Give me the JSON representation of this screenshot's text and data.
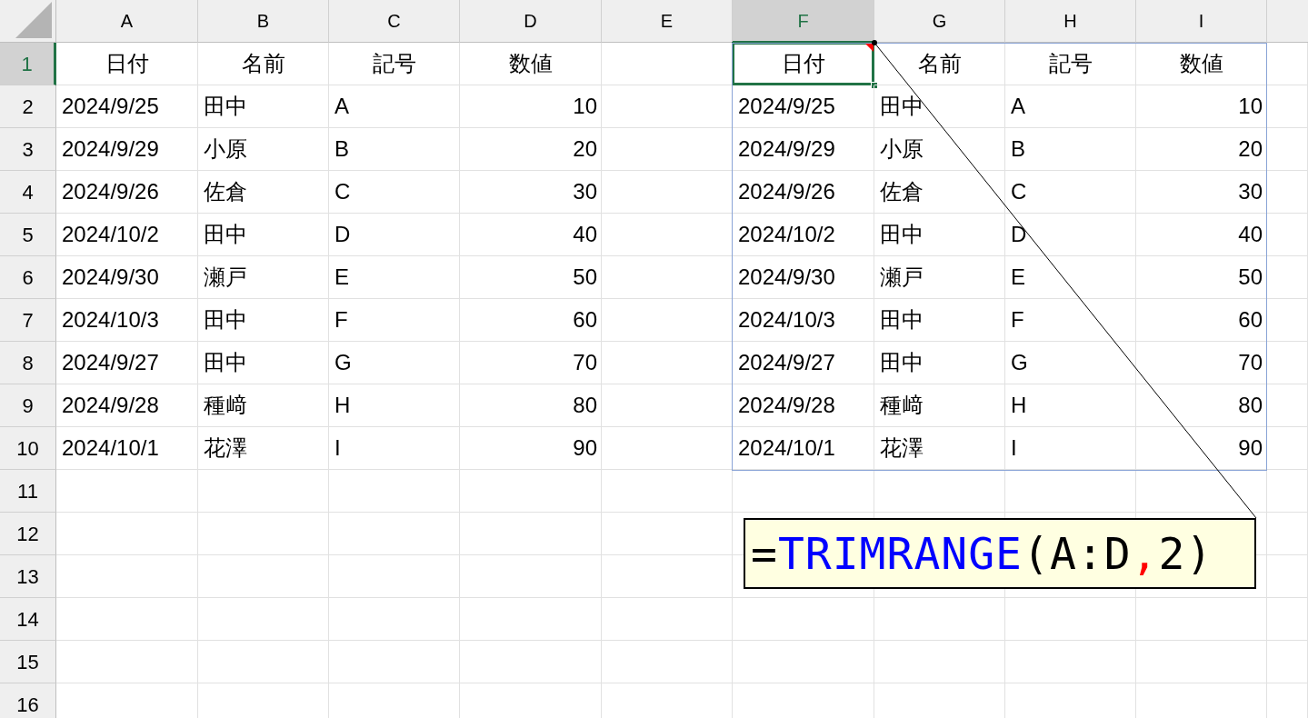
{
  "column_headers": [
    {
      "label": "A",
      "selected": false
    },
    {
      "label": "B",
      "selected": false
    },
    {
      "label": "C",
      "selected": false
    },
    {
      "label": "D",
      "selected": false
    },
    {
      "label": "E",
      "selected": false
    },
    {
      "label": "F",
      "selected": true
    },
    {
      "label": "G",
      "selected": false
    },
    {
      "label": "H",
      "selected": false
    },
    {
      "label": "I",
      "selected": false
    }
  ],
  "row_headers": [
    {
      "label": "1",
      "selected": true
    },
    {
      "label": "2",
      "selected": false
    },
    {
      "label": "3",
      "selected": false
    },
    {
      "label": "4",
      "selected": false
    },
    {
      "label": "5",
      "selected": false
    },
    {
      "label": "6",
      "selected": false
    },
    {
      "label": "7",
      "selected": false
    },
    {
      "label": "8",
      "selected": false
    },
    {
      "label": "9",
      "selected": false
    },
    {
      "label": "10",
      "selected": false
    },
    {
      "label": "11",
      "selected": false
    },
    {
      "label": "12",
      "selected": false
    },
    {
      "label": "13",
      "selected": false
    },
    {
      "label": "14",
      "selected": false
    },
    {
      "label": "15",
      "selected": false
    },
    {
      "label": "16",
      "selected": false
    }
  ],
  "source_table": {
    "header": [
      "日付",
      "名前",
      "記号",
      "数値"
    ],
    "rows": [
      [
        "2024/9/25",
        "田中",
        "A",
        "10"
      ],
      [
        "2024/9/29",
        "小原",
        "B",
        "20"
      ],
      [
        "2024/9/26",
        "佐倉",
        "C",
        "30"
      ],
      [
        "2024/10/2",
        "田中",
        "D",
        "40"
      ],
      [
        "2024/9/30",
        "瀬戸",
        "E",
        "50"
      ],
      [
        "2024/10/3",
        "田中",
        "F",
        "60"
      ],
      [
        "2024/9/27",
        "田中",
        "G",
        "70"
      ],
      [
        "2024/9/28",
        "種﨑",
        "H",
        "80"
      ],
      [
        "2024/10/1",
        "花澤",
        "I",
        "90"
      ]
    ]
  },
  "spill_table": {
    "header": [
      {
        "text": "日付",
        "selected": true,
        "has_note": true
      },
      {
        "text": "名前",
        "selected": false,
        "has_note": false
      },
      {
        "text": "記号",
        "selected": false,
        "has_note": false
      },
      {
        "text": "数値",
        "selected": false,
        "has_note": false
      }
    ],
    "rows": [
      [
        "2024/9/25",
        "田中",
        "A",
        "10"
      ],
      [
        "2024/9/29",
        "小原",
        "B",
        "20"
      ],
      [
        "2024/9/26",
        "佐倉",
        "C",
        "30"
      ],
      [
        "2024/10/2",
        "田中",
        "D",
        "40"
      ],
      [
        "2024/9/30",
        "瀬戸",
        "E",
        "50"
      ],
      [
        "2024/10/3",
        "田中",
        "F",
        "60"
      ],
      [
        "2024/9/27",
        "田中",
        "G",
        "70"
      ],
      [
        "2024/9/28",
        "種﨑",
        "H",
        "80"
      ],
      [
        "2024/10/1",
        "花澤",
        "I",
        "90"
      ]
    ]
  },
  "callout": {
    "segments": [
      {
        "text": "=",
        "color": "#000000"
      },
      {
        "text": "TRIMRANGE",
        "color": "#0000ff"
      },
      {
        "text": "(A:D",
        "color": "#000000"
      },
      {
        "text": ",",
        "color": "#ff0000"
      },
      {
        "text": "2)",
        "color": "#000000"
      }
    ]
  }
}
